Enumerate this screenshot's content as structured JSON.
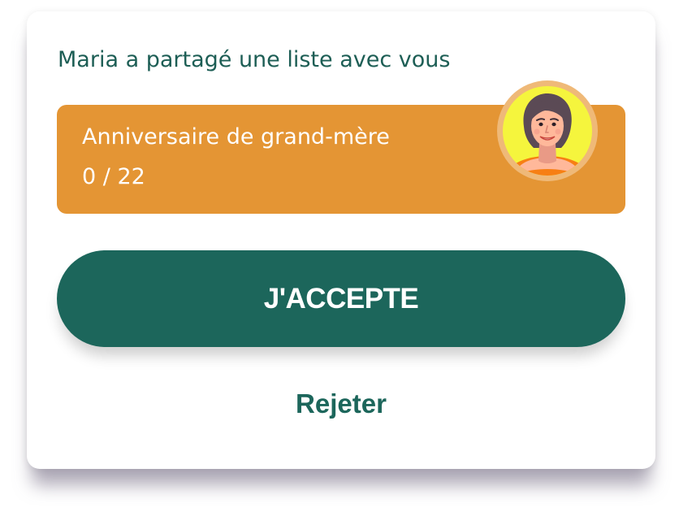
{
  "dialog": {
    "message": "Maria a partagé une liste avec vous",
    "list": {
      "title": "Anniversaire de grand-mère",
      "progress": "0 / 22"
    },
    "avatar": {
      "icon": "woman-avatar-icon"
    },
    "accept_label": "J'ACCEPTE",
    "reject_label": "Rejeter"
  },
  "colors": {
    "brand_green": "#1c665b",
    "card_orange": "#e49534",
    "avatar_ring": "#efb978",
    "avatar_background": "#f5f53d"
  }
}
